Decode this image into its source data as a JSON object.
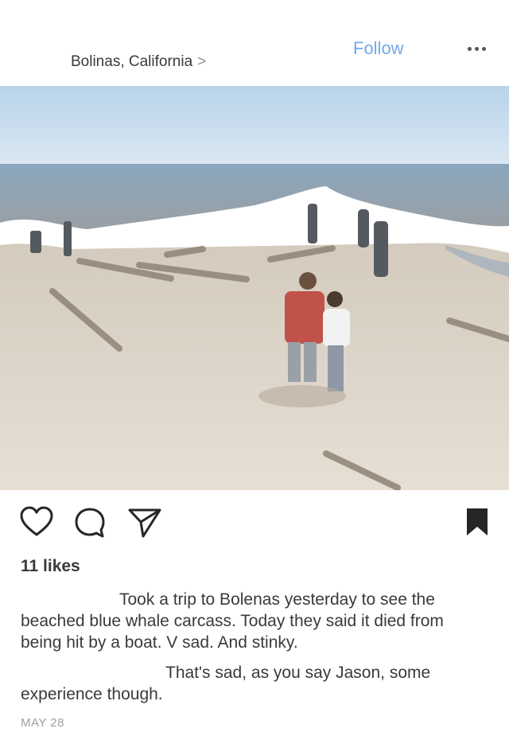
{
  "post": {
    "location": "Bolinas, California",
    "location_chevron": ">",
    "follow_label": "Follow",
    "more_icon": "more-horizontal-icon",
    "likes": "11 likes",
    "caption": "Took a trip to Bolenas yesterday to see the beached blue whale carcass. Today they said it died from being hit by a boat. V sad. And stinky.",
    "comment": "That's sad, as you say Jason, some experience though.",
    "date": "MAY 28"
  },
  "icons": {
    "like": "heart-icon",
    "comment": "comment-bubble-icon",
    "share": "send-icon",
    "save": "bookmark-icon"
  },
  "colors": {
    "follow": "#72a9e6",
    "text": "#3a3a3a",
    "muted": "#a0a0a0"
  }
}
